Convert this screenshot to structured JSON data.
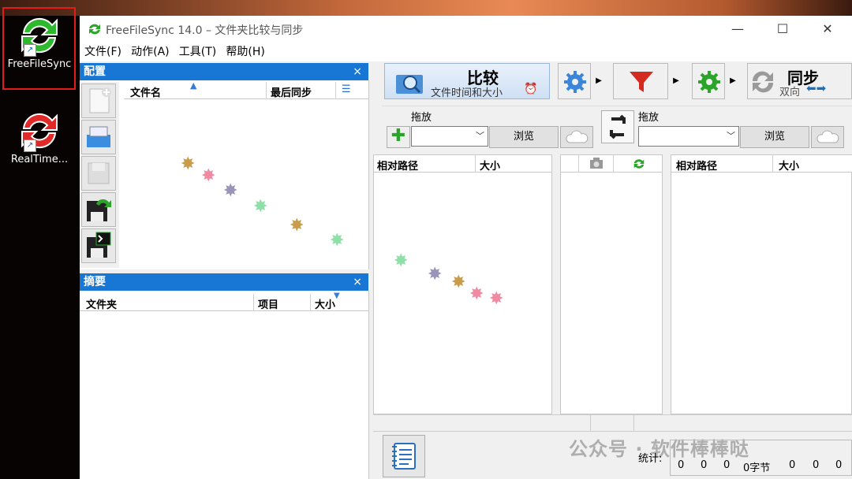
{
  "desktop": {
    "icons": [
      {
        "label": "FreeFileSync",
        "icon": "freefilesync-icon"
      },
      {
        "label": "RealTime...",
        "icon": "realtimesync-icon"
      }
    ]
  },
  "window": {
    "title": "FreeFileSync 14.0 – 文件夹比较与同步",
    "controls": {
      "minimize": "—",
      "maximize": "☐",
      "close": "✕"
    }
  },
  "menu": [
    "文件(F)",
    "动作(A)",
    "工具(T)",
    "帮助(H)"
  ],
  "config_pane": {
    "title": "配置",
    "close": "×",
    "columns": {
      "name": "文件名",
      "last_sync": "最后同步"
    }
  },
  "summary_pane": {
    "title": "摘要",
    "close": "×",
    "columns": {
      "folder": "文件夹",
      "items": "项目",
      "size": "大小"
    }
  },
  "toolbar": {
    "compare_label": "比较",
    "compare_sub": "文件时间和大小",
    "sync_label": "同步",
    "sync_sub": "双向"
  },
  "folders": {
    "left_label": "拖放",
    "right_label": "拖放",
    "browse": "浏览"
  },
  "grid": {
    "left_cols": {
      "path": "相对路径",
      "size": "大小"
    },
    "right_cols": {
      "path": "相对路径",
      "size": "大小"
    }
  },
  "statusbar": {
    "stats_label": "统计:",
    "values": [
      "0",
      "0",
      "0",
      "0字节",
      "0",
      "0",
      "0"
    ]
  },
  "watermark": "公众号 · 软件棒棒哒",
  "colors": {
    "accent": "#1877d4",
    "sync_green": "#2aa52a",
    "highlight_red": "#e51a1a"
  }
}
